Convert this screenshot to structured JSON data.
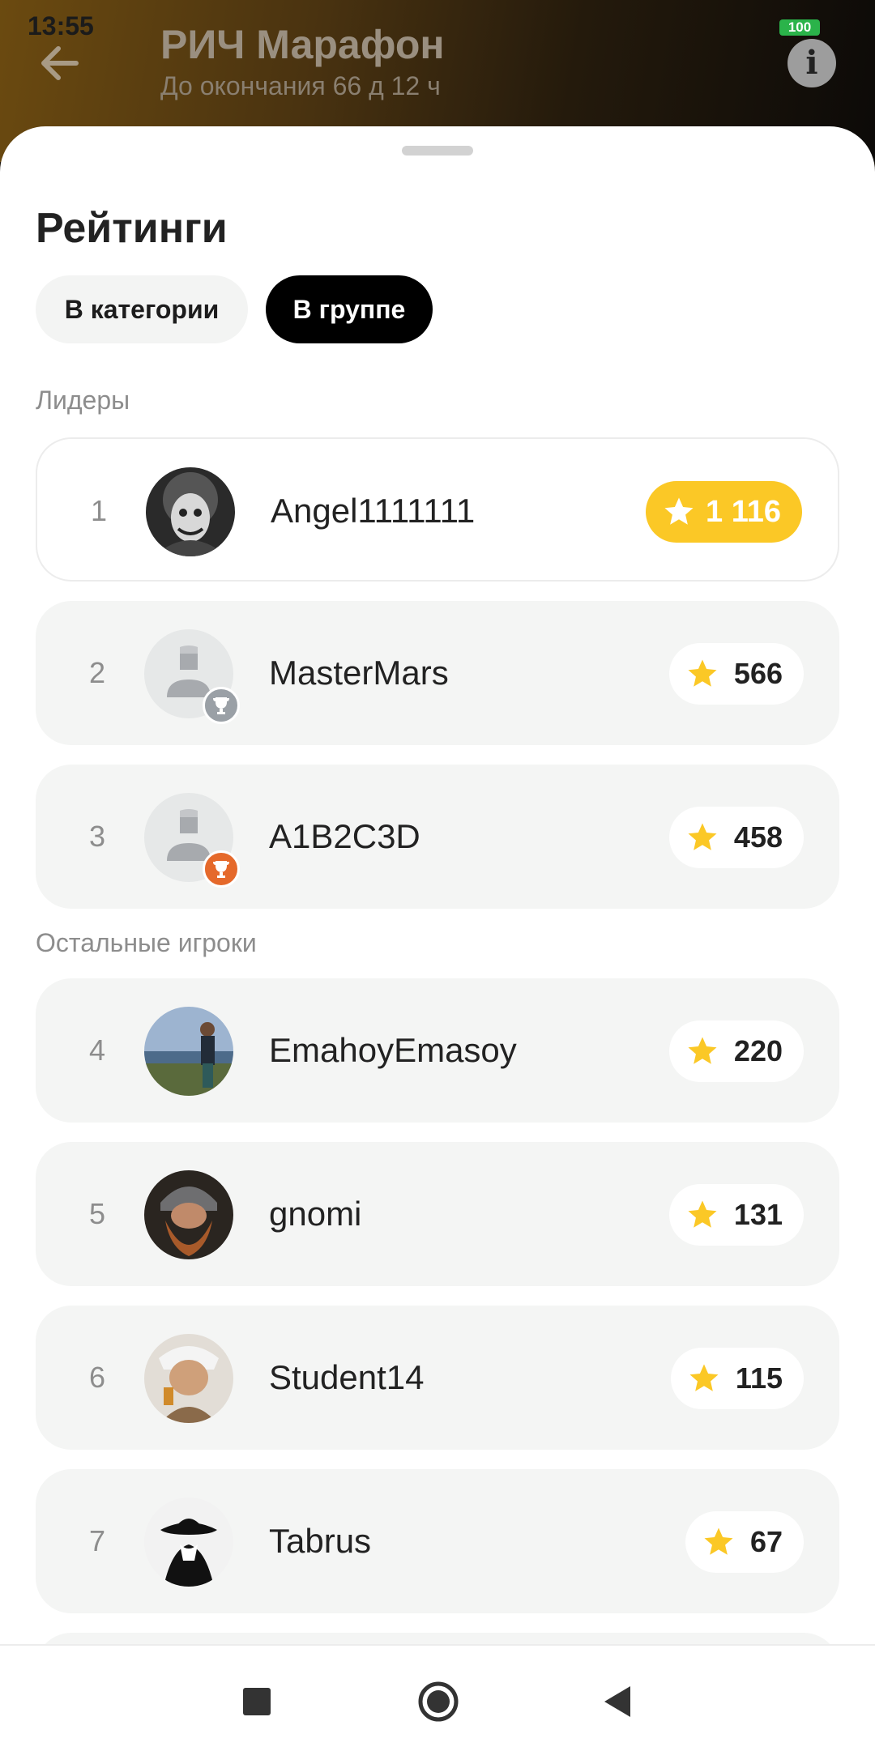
{
  "status_bar": {
    "time": "13:55",
    "battery": "100"
  },
  "header": {
    "title": "РИЧ Марафон",
    "subtitle": "До окончания 66 д 12 ч"
  },
  "sheet": {
    "title": "Рейтинги",
    "tabs": [
      {
        "label": "В категории",
        "selected": false
      },
      {
        "label": "В группе",
        "selected": true
      }
    ],
    "leaders_label": "Лидеры",
    "others_label": "Остальные игроки"
  },
  "leaders": [
    {
      "rank": "1",
      "name": "Angel1111111",
      "score": "1 116"
    },
    {
      "rank": "2",
      "name": "MasterMars",
      "score": "566"
    },
    {
      "rank": "3",
      "name": "A1B2C3D",
      "score": "458"
    }
  ],
  "others": [
    {
      "rank": "4",
      "name": "EmahoyEmasoy",
      "score": "220"
    },
    {
      "rank": "5",
      "name": "gnomi",
      "score": "131"
    },
    {
      "rank": "6",
      "name": "Student14",
      "score": "115"
    },
    {
      "rank": "7",
      "name": "Tabrus",
      "score": "67"
    }
  ],
  "colors": {
    "gold": "#fbc826",
    "silver": "#9aa0a6",
    "bronze": "#e5692b",
    "selected_tab": "#000000"
  }
}
